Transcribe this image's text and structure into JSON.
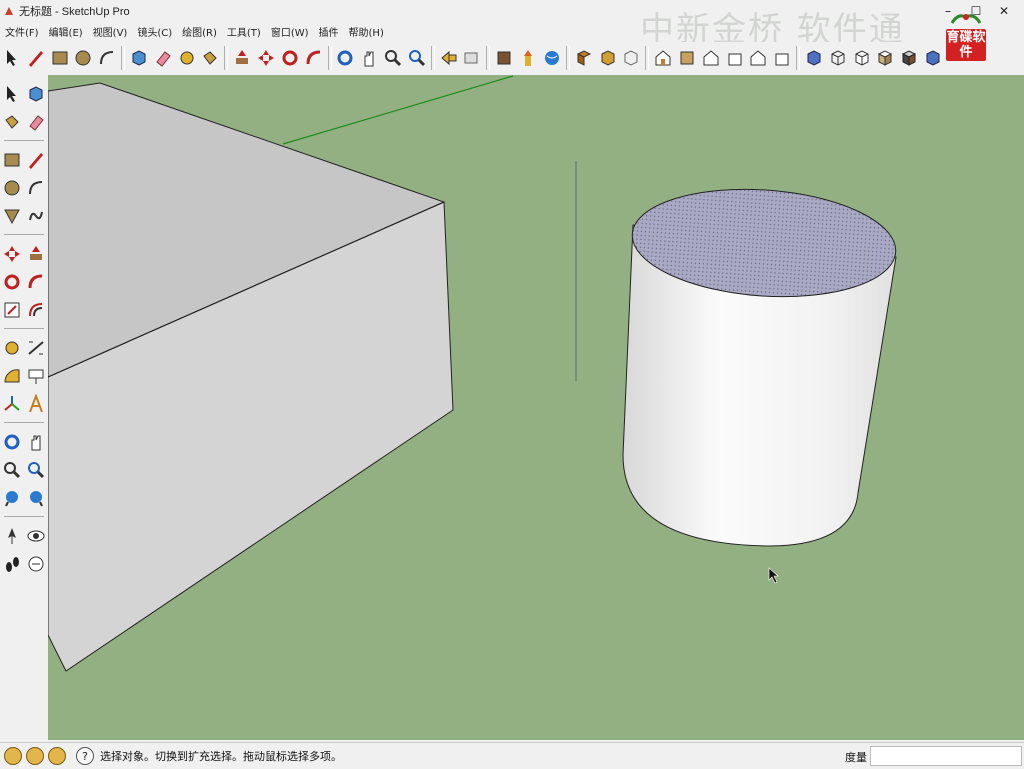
{
  "window": {
    "title": "无标题 - SketchUp Pro",
    "watermark": "中新金桥 软件通",
    "logo_text": "育碟软件",
    "buttons": [
      "–",
      "☐",
      "✕"
    ]
  },
  "menu": {
    "items": [
      "文件(F)",
      "编辑(E)",
      "视图(V)",
      "镜头(C)",
      "绘图(R)",
      "工具(T)",
      "窗口(W)",
      "插件",
      "帮助(H)"
    ]
  },
  "toolbar": {
    "icons": [
      "select-icon",
      "pencil-icon",
      "rectangle-icon",
      "circle-icon",
      "arc-icon",
      "make-component-icon",
      "eraser-icon",
      "tape-measure-icon",
      "paint-bucket-icon",
      "push-pull-icon",
      "move-icon",
      "rotate-icon",
      "follow-me-icon",
      "orbit-icon",
      "pan-icon",
      "zoom-icon",
      "zoom-extents-icon",
      "previous-view-icon",
      "next-view-icon",
      "3d-warehouse-icon",
      "share-model-icon",
      "google-earth-icon",
      "get-models-icon",
      "share-component-icon",
      "component-icon",
      "iso-view-icon",
      "top-view-icon",
      "front-view-icon",
      "right-view-icon",
      "back-view-icon",
      "left-view-icon",
      "xray-icon",
      "wireframe-icon",
      "hidden-line-icon",
      "shaded-icon",
      "shaded-textures-icon",
      "monochrome-icon"
    ]
  },
  "left_toolbar": {
    "icons": [
      "select-icon",
      "make-component-icon",
      "paint-bucket-icon",
      "eraser-icon",
      "rectangle-icon",
      "line-icon",
      "circle-icon",
      "arc-icon",
      "polygon-icon",
      "freehand-icon",
      "move-icon",
      "push-pull-icon",
      "rotate-icon",
      "follow-me-icon",
      "scale-icon",
      "offset-icon",
      "tape-measure-icon",
      "dimension-icon",
      "protractor-icon",
      "text-icon",
      "axes-icon",
      "3d-text-icon",
      "orbit-icon",
      "pan-icon",
      "zoom-icon",
      "zoom-extents-icon",
      "previous-icon",
      "next-icon",
      "position-camera-icon",
      "look-around-icon",
      "walk-icon",
      "section-plane-icon"
    ]
  },
  "viewport": {
    "background": "#93b083"
  },
  "status": {
    "message": "选择对象。切换到扩充选择。拖动鼠标选择多项。",
    "measure_label": "度量",
    "measure_value": ""
  }
}
